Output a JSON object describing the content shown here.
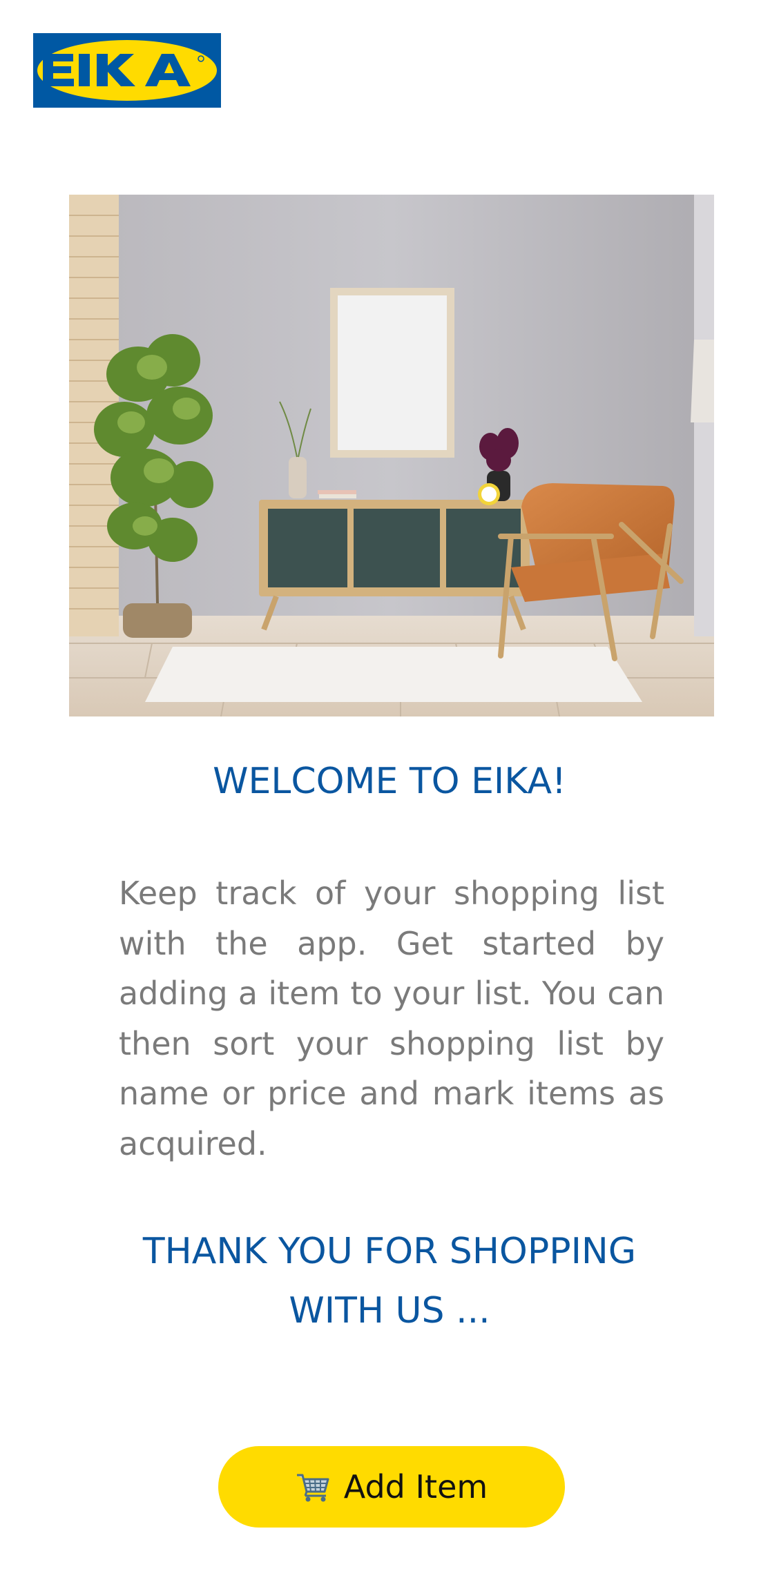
{
  "brand": {
    "logo_text": "EIKA",
    "icon": "eika-logo",
    "colors": {
      "blue": "#0058a3",
      "yellow": "#ffdb00"
    }
  },
  "hero": {
    "icon": "living-room-photo"
  },
  "main": {
    "welcome_title": "WELCOME TO EIKA!",
    "description": "Keep track of your shopping list with the app. Get started by adding a item to your list. You can then sort your shopping list by name or price and mark items as acquired.",
    "thanks_message": "THANK YOU FOR SHOPPING WITH US ..."
  },
  "actions": {
    "add_item_label": "Add Item",
    "add_item_icon": "shopping-cart-icon"
  },
  "colors": {
    "heading": "#0a56a0",
    "body_text": "#7a7a7a",
    "button": "#ffdb00"
  }
}
